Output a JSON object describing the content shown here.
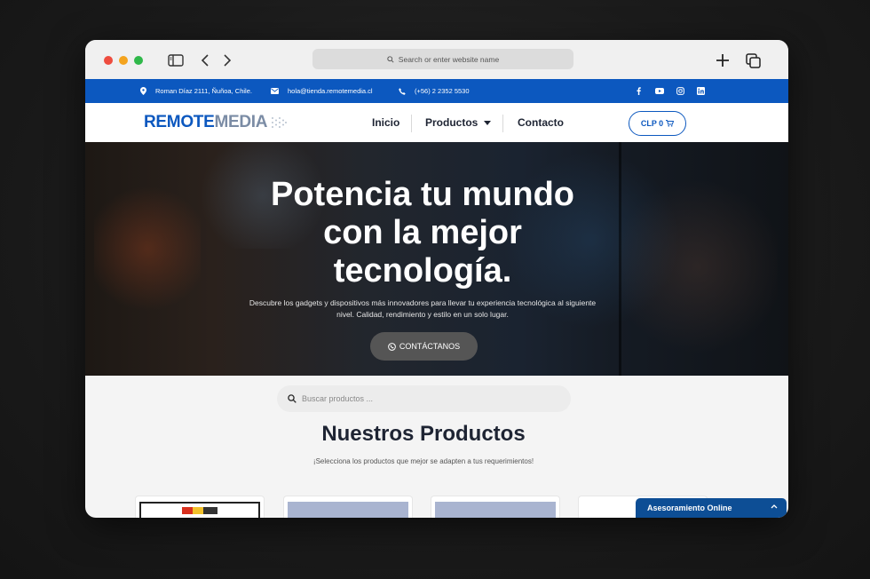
{
  "browser": {
    "address_placeholder": "Search or enter website name"
  },
  "topbar": {
    "address": "Roman Díaz 2111, Ñuñoa, Chile.",
    "email": "hola@tienda.remotemedia.cl",
    "phone": "(+56) 2 2352 5530",
    "social": [
      "facebook-icon",
      "youtube-icon",
      "instagram-icon",
      "linkedin-icon"
    ]
  },
  "nav": {
    "logo_part1": "REMOTE",
    "logo_part2": "MEDIA",
    "items": [
      "Inicio",
      "Productos",
      "Contacto"
    ],
    "cart_label": "CLP 0"
  },
  "hero": {
    "title": "Potencia tu mundo con la mejor tecnología.",
    "subtitle": "Descubre los gadgets y dispositivos más innovadores para llevar tu experiencia tecnológica al siguiente nivel. Calidad, rendimiento y estilo en un solo lugar.",
    "cta": "CONTÁCTANOS"
  },
  "search": {
    "placeholder": "Buscar productos ..."
  },
  "products": {
    "title": "Nuestros Productos",
    "subtitle": "¡Selecciona los productos que mejor se adapten a tus requerimientos!"
  },
  "chat": {
    "label": "Asesoramiento Online"
  },
  "colors": {
    "brand_blue": "#0c58bf",
    "chat_blue": "#0d4e95"
  }
}
